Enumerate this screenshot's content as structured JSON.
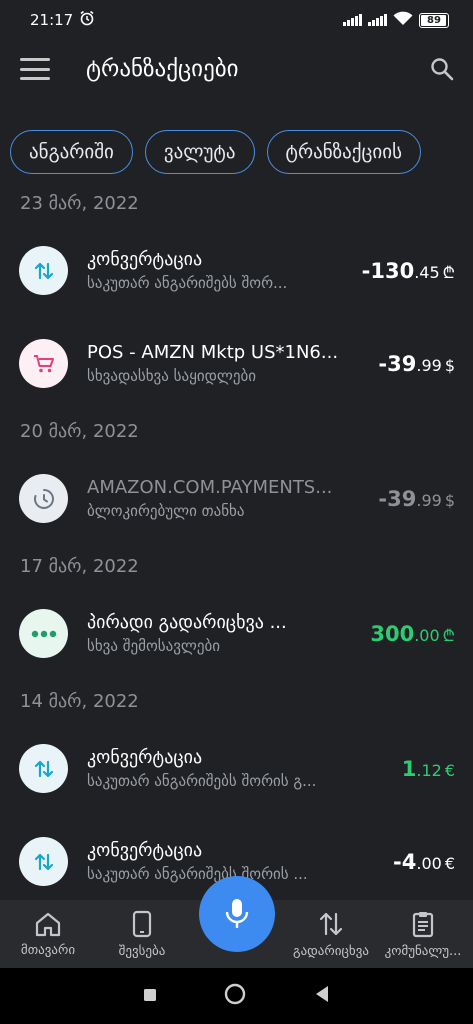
{
  "status": {
    "time": "21:17",
    "battery": "89"
  },
  "appbar": {
    "title": "ტრანზაქციები"
  },
  "chips": [
    "ანგარიში",
    "ვალუტა",
    "ტრანზაქციის"
  ],
  "groups": [
    {
      "date": "23 მარ, 2022",
      "items": [
        {
          "title": "კონვერტაცია",
          "subtitle": "საკუთარ ანგარიშებს შორ...",
          "int": "-130",
          "dec": ".45",
          "cur": "₾",
          "icon": "swap-icon"
        },
        {
          "title": "POS - AMZN Mktp US*1N6...",
          "subtitle": "სხვადასხვა საყიდლები",
          "int": "-39",
          "dec": ".99",
          "cur": "$",
          "icon": "cart-icon"
        }
      ]
    },
    {
      "date": "20 მარ, 2022",
      "items": [
        {
          "title": "AMAZON.COM.PAYMENTS...",
          "subtitle": "ბლოკირებული თანხა",
          "int": "-39",
          "dec": ".99",
          "cur": "$",
          "icon": "clock-icon"
        }
      ]
    },
    {
      "date": "17 მარ, 2022",
      "items": [
        {
          "title": "პირადი გადარიცხვა ...",
          "subtitle": "სხვა შემოსავლები",
          "int": "300",
          "dec": ".00",
          "cur": "₾",
          "icon": "more-dots-icon"
        }
      ]
    },
    {
      "date": "14 მარ, 2022",
      "items": [
        {
          "title": "კონვერტაცია",
          "subtitle": "საკუთარ ანგარიშებს შორის გ...",
          "int": "1",
          "dec": ".12",
          "cur": "€",
          "icon": "swap-icon"
        },
        {
          "title": "კონვერტაცია",
          "subtitle": "საკუთარ ანგარიშებს შორის ...",
          "int": "-4",
          "dec": ".00",
          "cur": "€",
          "icon": "swap-icon"
        }
      ]
    }
  ],
  "nav": {
    "home": "მთავარი",
    "topup": "შევსება",
    "transfer": "გადარიცხვა",
    "utility": "კომუნალუ..."
  },
  "colors": {
    "accent": "#3d8bf0",
    "positive": "#2ecc71",
    "chip_border": "#4a90e2"
  }
}
